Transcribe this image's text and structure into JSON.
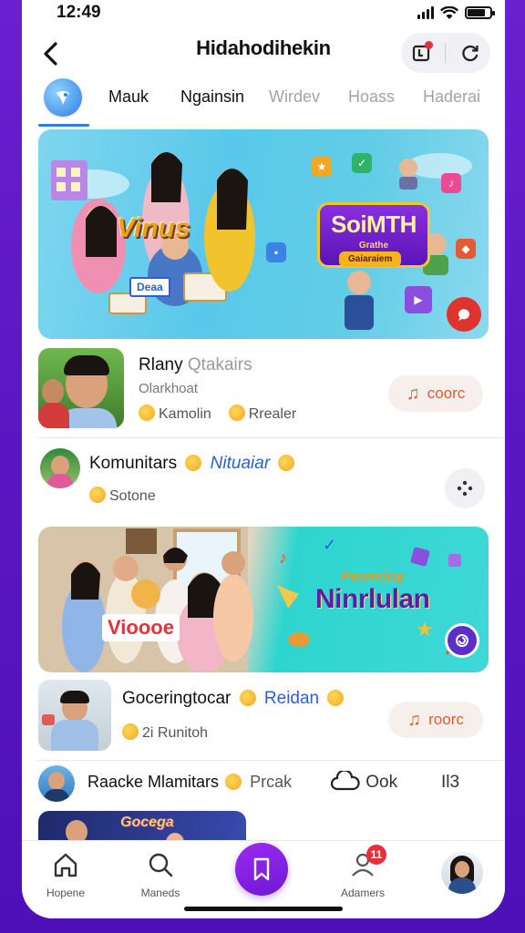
{
  "status": {
    "time": "12:49"
  },
  "header": {
    "title": "Hidahodihekin"
  },
  "tabs": [
    {
      "label": "Mauk"
    },
    {
      "label": "Ngainsin"
    },
    {
      "label": "Wirdev"
    },
    {
      "label": "Hoass"
    },
    {
      "label": "Haderai"
    }
  ],
  "banner1": {
    "left_text": "Vinus",
    "right_big": "SoiMTH",
    "right_small": "Grathe",
    "cta": "Gaiaraiem",
    "badge": "Deaa"
  },
  "item1": {
    "title_a": "Rlany",
    "title_b": "Qtakairs",
    "sub_top": "Olarkhoat",
    "tag_a": "Kamolin",
    "tag_b": "Rrealer",
    "pill": "coorc"
  },
  "community": {
    "name": "Komunitars",
    "link": "Nituaiar",
    "sub": "Sotone"
  },
  "banner2": {
    "left_text": "Vioooe",
    "right_small": "Penmring",
    "right_big": "Ninrlulan"
  },
  "item2": {
    "title": "Goceringtocar",
    "link": "Reidan",
    "sub": "2i Runitoh",
    "pill": "roorc"
  },
  "footer_row": {
    "name": "Raacke Mlamitars",
    "action_a": "Prcak",
    "action_b": "Ook",
    "action_c": "Il3"
  },
  "bottom_banner": {
    "text": "Gocega"
  },
  "tabbar": {
    "home": "Hopene",
    "search": "Maneds",
    "profile": "Adamers",
    "badge": "11"
  },
  "colors": {
    "accent": "#7017d6",
    "link": "#2a5fd6",
    "pill_text": "#e35a33"
  }
}
